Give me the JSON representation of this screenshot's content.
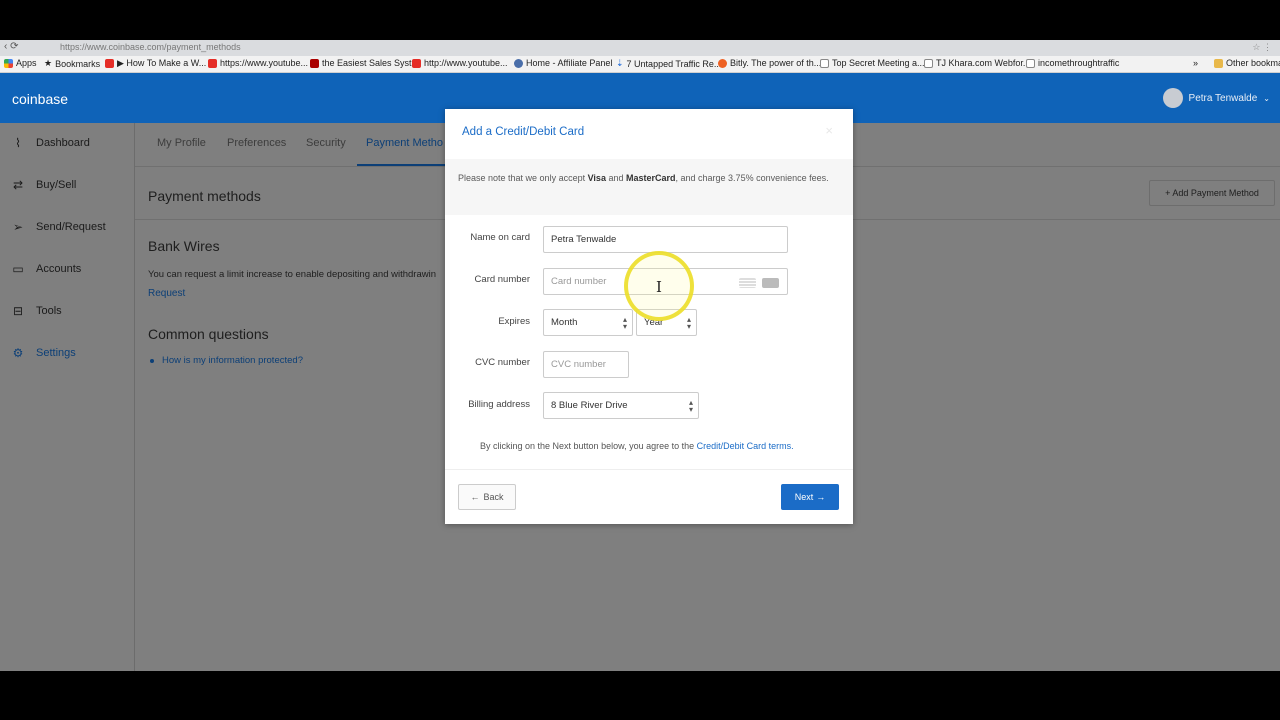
{
  "browser": {
    "url_fragment": "https://www.coinbase.com/payment_methods",
    "bookmarks": [
      {
        "label": "Apps",
        "icon": "apps-icon"
      },
      {
        "label": "Bookmarks",
        "icon": "star-icon"
      },
      {
        "label": "▶ How To Make a W...",
        "icon": "youtube-icon"
      },
      {
        "label": "https://www.youtube...",
        "icon": "youtube-icon"
      },
      {
        "label": "the Easiest Sales Syst...",
        "icon": "site-icon"
      },
      {
        "label": "http://www.youtube...",
        "icon": "youtube-icon"
      },
      {
        "label": "Home - Affiliate Panel",
        "icon": "affiliate-icon"
      },
      {
        "label": "7 Untapped Traffic Re...",
        "icon": "traffic-icon"
      },
      {
        "label": "Bitly. The power of th...",
        "icon": "bitly-icon"
      },
      {
        "label": "Top Secret Meeting a...",
        "icon": "page-icon"
      },
      {
        "label": "TJ Khara.com Webfor...",
        "icon": "page-icon"
      },
      {
        "label": "incomethroughtraffic",
        "icon": "page-icon"
      },
      {
        "label": "»",
        "icon": ""
      },
      {
        "label": "Other bookmarks",
        "icon": "folder-icon"
      }
    ]
  },
  "header": {
    "logo": "coinbase",
    "user_name": "Petra Tenwalde"
  },
  "sidebar": {
    "items": [
      {
        "label": "Dashboard",
        "icon": "activity-icon"
      },
      {
        "label": "Buy/Sell",
        "icon": "exchange-icon"
      },
      {
        "label": "Send/Request",
        "icon": "send-icon"
      },
      {
        "label": "Accounts",
        "icon": "wallet-icon"
      },
      {
        "label": "Tools",
        "icon": "briefcase-icon"
      },
      {
        "label": "Settings",
        "icon": "gear-icon"
      }
    ],
    "active": "Settings"
  },
  "main": {
    "tabs": [
      "My Profile",
      "Preferences",
      "Security",
      "Payment Metho"
    ],
    "active_tab": "Payment Metho",
    "page_title": "Payment methods",
    "add_button": "+ Add Payment Method",
    "bank_wires": {
      "title": "Bank Wires",
      "text": "You can request a limit increase to enable depositing and withdrawin",
      "link": "Request"
    },
    "common_questions": {
      "title": "Common questions",
      "items": [
        "How is my information protected?"
      ]
    }
  },
  "modal": {
    "title": "Add a Credit/Debit Card",
    "close": "×",
    "notice": {
      "prefix": "Please note that we only accept ",
      "visa": "Visa",
      "and": " and ",
      "mastercard": "MasterCard",
      "suffix": ", and charge 3.75% convenience fees."
    },
    "fields": {
      "name_label": "Name on card",
      "name_value": "Petra Tenwalde",
      "card_label": "Card number",
      "card_placeholder": "Card number",
      "expires_label": "Expires",
      "month_value": "Month",
      "year_value": "Year",
      "cvc_label": "CVC number",
      "cvc_placeholder": "CVC number",
      "billing_label": "Billing address",
      "billing_value": "8 Blue River Drive"
    },
    "terms": {
      "text": "By clicking on the Next button below, you agree to the ",
      "link": "Credit/Debit Card terms."
    },
    "back_button": "Back",
    "next_button": "Next"
  },
  "colors": {
    "brand": "#0f63b8",
    "link": "#1b6cc7",
    "overlay": "#7f7f7f",
    "cursor_highlight": "#ecde28"
  }
}
